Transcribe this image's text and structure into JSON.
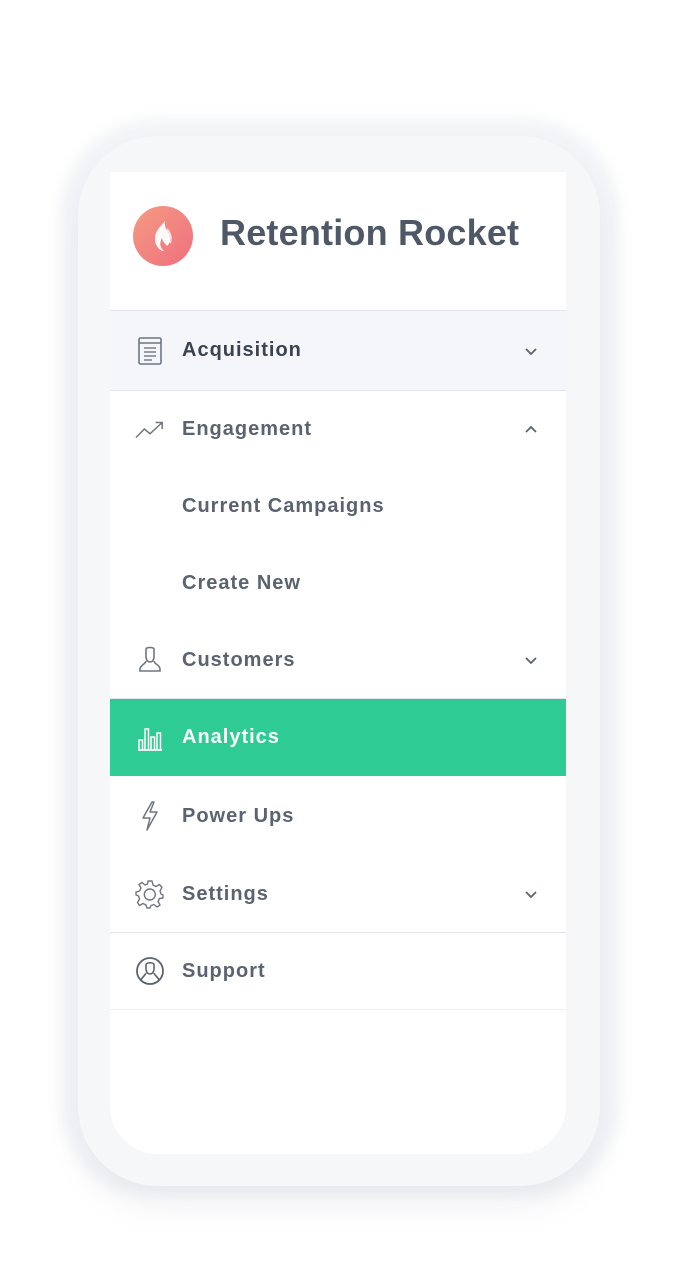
{
  "brand": {
    "title": "Retention Rocket",
    "logo_icon": "flame-icon",
    "logo_gradient": [
      "#f59b84",
      "#ef6f7d"
    ]
  },
  "colors": {
    "active_bg": "#2ecb95",
    "text": "#5b6370",
    "title": "#4f5866",
    "hover_bg": "#f5f6fa"
  },
  "menu": {
    "acquisition": {
      "label": "Acquisition",
      "icon": "document-icon",
      "chevron": "chevron-down-icon"
    },
    "engagement": {
      "label": "Engagement",
      "icon": "trend-up-icon",
      "chevron": "chevron-up-icon"
    },
    "current_campaigns": {
      "label": "Current Campaigns"
    },
    "create_new": {
      "label": "Create New"
    },
    "customers": {
      "label": "Customers",
      "icon": "user-icon",
      "chevron": "chevron-down-icon"
    },
    "analytics": {
      "label": "Analytics",
      "icon": "bar-chart-icon"
    },
    "power_ups": {
      "label": "Power Ups",
      "icon": "lightning-icon"
    },
    "settings": {
      "label": "Settings",
      "icon": "gear-icon",
      "chevron": "chevron-down-icon"
    },
    "support": {
      "label": "Support",
      "icon": "support-icon"
    }
  }
}
